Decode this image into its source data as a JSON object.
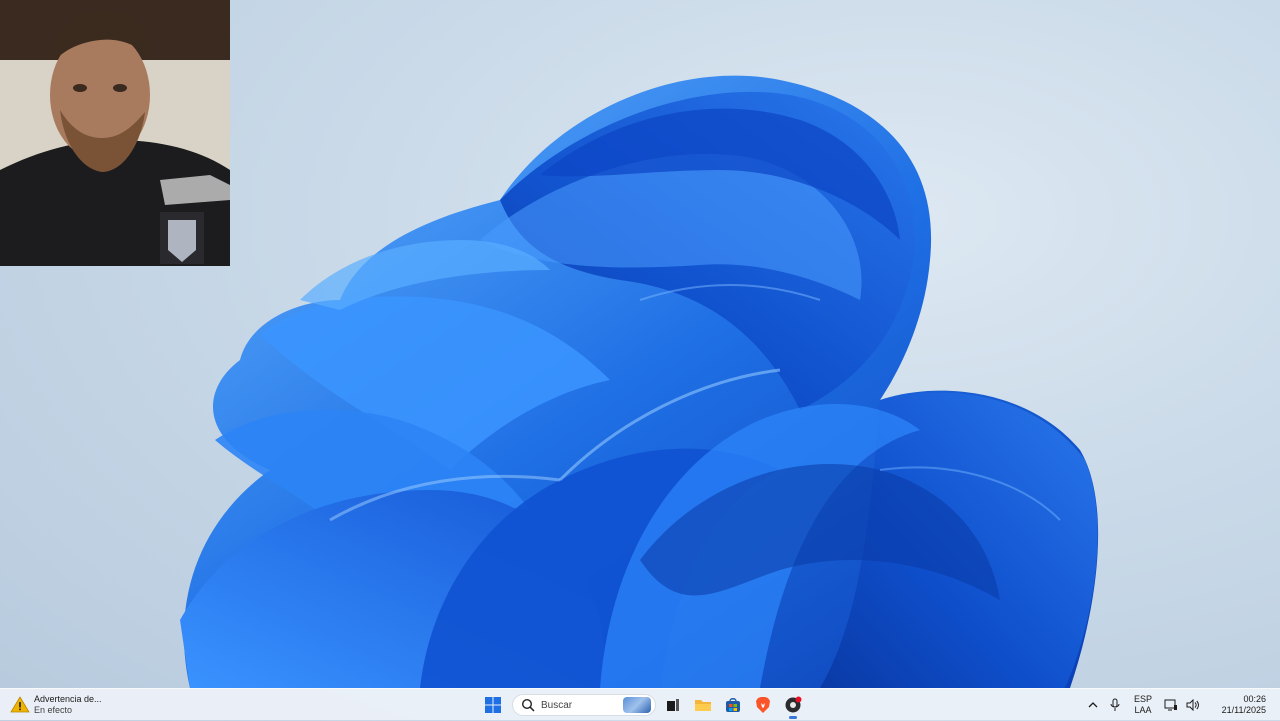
{
  "taskbar": {
    "weather": {
      "title": "Advertencia de...",
      "status": "En efecto",
      "icon": "warning-icon"
    },
    "search": {
      "placeholder": "Buscar",
      "icon": "search-icon"
    },
    "apps": [
      {
        "name": "start-button",
        "icon": "windows-logo-icon"
      },
      {
        "name": "task-view-button",
        "icon": "task-view-icon"
      },
      {
        "name": "file-explorer-button",
        "icon": "folder-icon"
      },
      {
        "name": "microsoft-store-button",
        "icon": "store-icon"
      },
      {
        "name": "brave-browser-button",
        "icon": "brave-lion-icon"
      },
      {
        "name": "obs-button",
        "icon": "record-icon"
      }
    ],
    "tray": {
      "language_line1": "ESP",
      "language_line2": "LAA",
      "time": "00:26",
      "date": "21/11/2025"
    }
  },
  "colors": {
    "accent": "#1f6fe5",
    "bloom_dark": "#0a3fb8",
    "bloom_light": "#4aa0ff",
    "background": "#c9d9e8",
    "warning": "#f0b400"
  }
}
